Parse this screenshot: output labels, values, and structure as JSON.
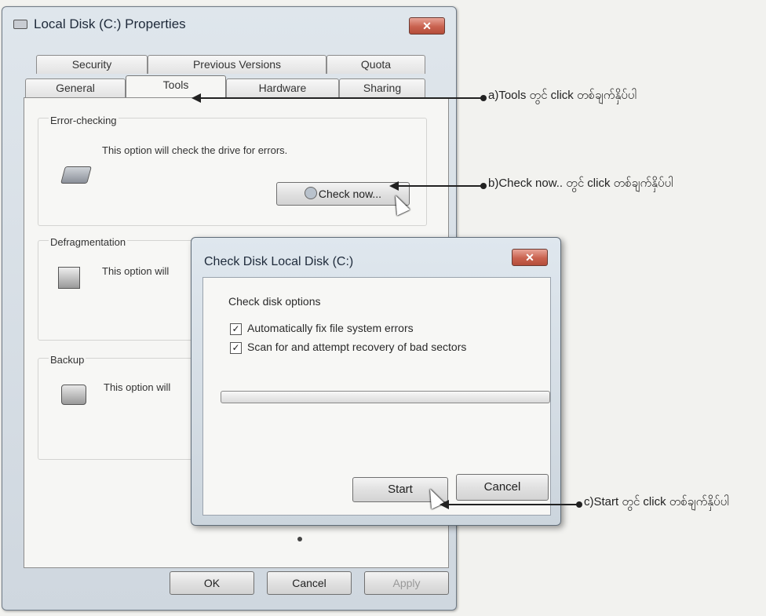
{
  "properties_window": {
    "title": "Local Disk (C:) Properties",
    "close_label": "✕",
    "tabs_row1": [
      "Security",
      "Previous Versions",
      "Quota"
    ],
    "tabs_row2": [
      "General",
      "Tools",
      "Hardware",
      "Sharing"
    ],
    "active_tab": "Tools",
    "error_checking": {
      "label": "Error-checking",
      "description": "This option will check the drive for errors.",
      "button": "Check now..."
    },
    "defragmentation": {
      "label": "Defragmentation",
      "description": "This option will"
    },
    "backup": {
      "label": "Backup",
      "description": "This option will"
    },
    "footer": {
      "ok": "OK",
      "cancel": "Cancel",
      "apply": "Apply"
    }
  },
  "check_disk_dialog": {
    "title": "Check Disk Local Disk (C:)",
    "close_label": "✕",
    "options_label": "Check disk options",
    "option1": "Automatically fix file system errors",
    "option1_checked": true,
    "option2": "Scan for and attempt recovery of bad sectors",
    "option2_checked": true,
    "check_mark": "✓",
    "progress": 0,
    "start": "Start",
    "cancel": "Cancel"
  },
  "annotations": {
    "a": "a)Tools တွင် click တစ်ချက်နှိပ်ပါ",
    "b": "b)Check now.. တွင် click တစ်ချက်နှိပ်ပါ",
    "c": "c)Start တွင် click တစ်ချက်နှိပ်ပါ"
  },
  "colors": {
    "close_button": "#c9624f",
    "window_frame": "#cfd7df",
    "background": "#f2f2ef"
  },
  "icons": [
    "drive-icon",
    "defrag-icon",
    "backup-icon",
    "mouse-cursor-icon",
    "check-now-shield-icon"
  ]
}
